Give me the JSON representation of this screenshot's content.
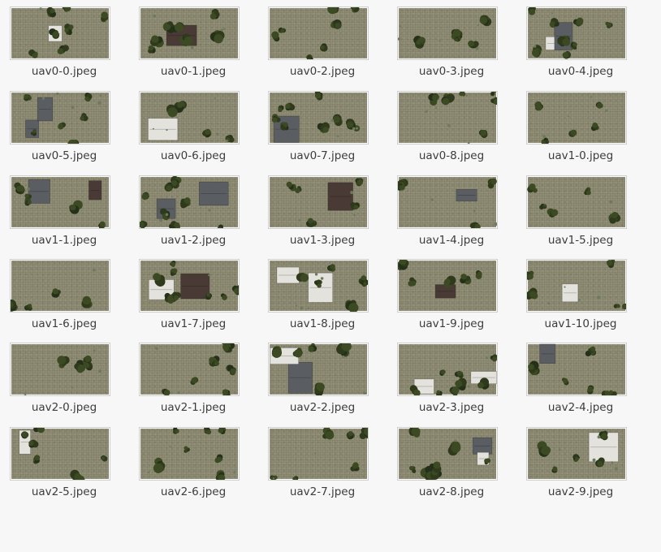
{
  "files": [
    {
      "name": "uav0-0.jpeg",
      "icon": "image-thumbnail-icon"
    },
    {
      "name": "uav0-1.jpeg",
      "icon": "image-thumbnail-icon"
    },
    {
      "name": "uav0-2.jpeg",
      "icon": "image-thumbnail-icon"
    },
    {
      "name": "uav0-3.jpeg",
      "icon": "image-thumbnail-icon"
    },
    {
      "name": "uav0-4.jpeg",
      "icon": "image-thumbnail-icon"
    },
    {
      "name": "uav0-5.jpeg",
      "icon": "image-thumbnail-icon"
    },
    {
      "name": "uav0-6.jpeg",
      "icon": "image-thumbnail-icon"
    },
    {
      "name": "uav0-7.jpeg",
      "icon": "image-thumbnail-icon"
    },
    {
      "name": "uav0-8.jpeg",
      "icon": "image-thumbnail-icon"
    },
    {
      "name": "uav1-0.jpeg",
      "icon": "image-thumbnail-icon"
    },
    {
      "name": "uav1-1.jpeg",
      "icon": "image-thumbnail-icon"
    },
    {
      "name": "uav1-2.jpeg",
      "icon": "image-thumbnail-icon"
    },
    {
      "name": "uav1-3.jpeg",
      "icon": "image-thumbnail-icon"
    },
    {
      "name": "uav1-4.jpeg",
      "icon": "image-thumbnail-icon"
    },
    {
      "name": "uav1-5.jpeg",
      "icon": "image-thumbnail-icon"
    },
    {
      "name": "uav1-6.jpeg",
      "icon": "image-thumbnail-icon"
    },
    {
      "name": "uav1-7.jpeg",
      "icon": "image-thumbnail-icon"
    },
    {
      "name": "uav1-8.jpeg",
      "icon": "image-thumbnail-icon"
    },
    {
      "name": "uav1-9.jpeg",
      "icon": "image-thumbnail-icon"
    },
    {
      "name": "uav1-10.jpeg",
      "icon": "image-thumbnail-icon"
    },
    {
      "name": "uav2-0.jpeg",
      "icon": "image-thumbnail-icon"
    },
    {
      "name": "uav2-1.jpeg",
      "icon": "image-thumbnail-icon"
    },
    {
      "name": "uav2-2.jpeg",
      "icon": "image-thumbnail-icon"
    },
    {
      "name": "uav2-3.jpeg",
      "icon": "image-thumbnail-icon"
    },
    {
      "name": "uav2-4.jpeg",
      "icon": "image-thumbnail-icon"
    },
    {
      "name": "uav2-5.jpeg",
      "icon": "image-thumbnail-icon"
    },
    {
      "name": "uav2-6.jpeg",
      "icon": "image-thumbnail-icon"
    },
    {
      "name": "uav2-7.jpeg",
      "icon": "image-thumbnail-icon"
    },
    {
      "name": "uav2-8.jpeg",
      "icon": "image-thumbnail-icon"
    },
    {
      "name": "uav2-9.jpeg",
      "icon": "image-thumbnail-icon"
    }
  ],
  "colors": {
    "background": "#f7f7f7",
    "label_text": "#3c3c3c",
    "thumbnail_ground": "#8f8c74",
    "thumbnail_border": "#cfcfcf"
  }
}
